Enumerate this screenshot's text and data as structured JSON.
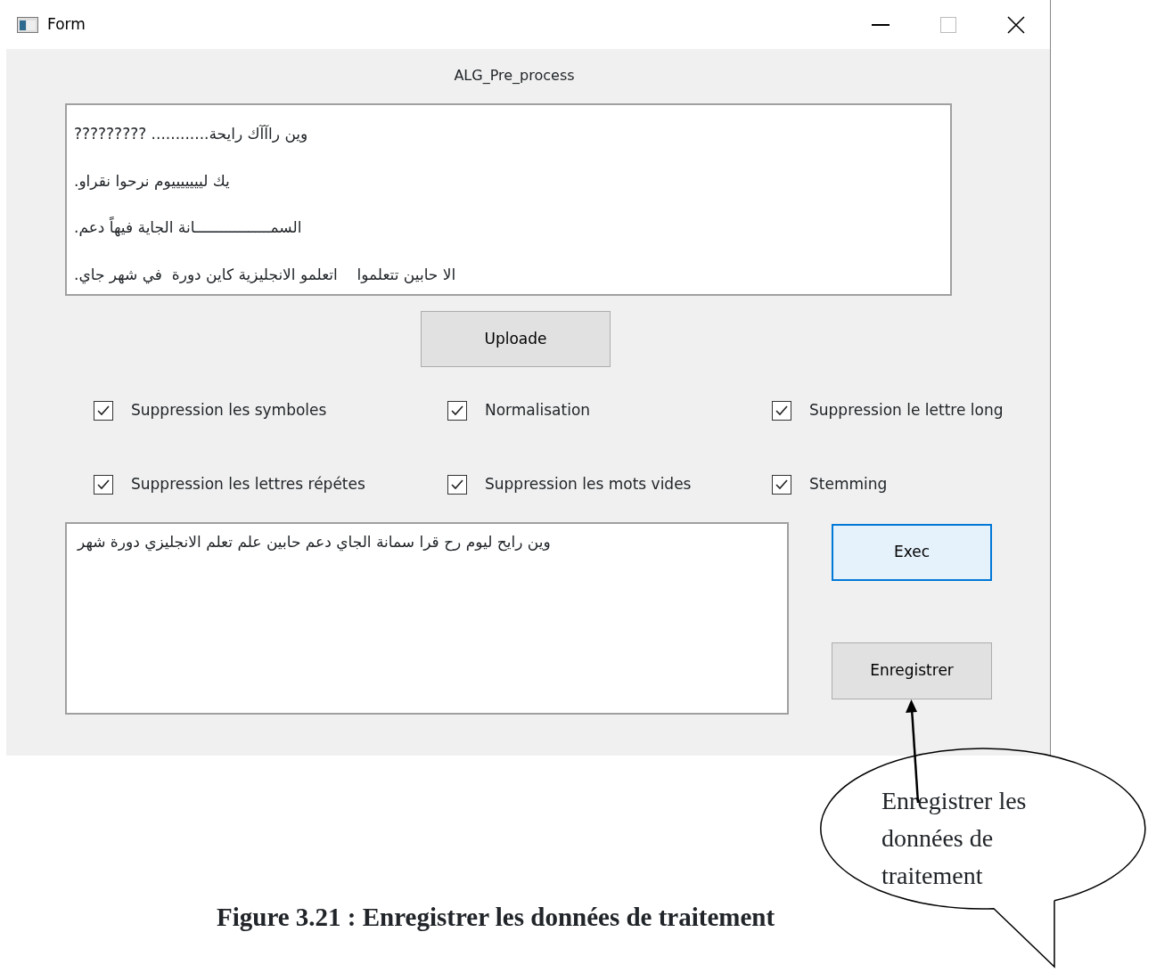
{
  "window": {
    "title": "Form"
  },
  "heading": "ALG_Pre_process",
  "input_lines": [
    "وين راآآك رايحة............ ?????????",
    "يك ليييييييوم نرحوا نقراو.",
    "السمـــــــــــــــــانة الجاية فيهاً دعم.",
    "الا حابين تتعلموا    اتعلمو الانجليزية كاين دورة  في شهر جاي."
  ],
  "upload_button": {
    "label": "Uploade"
  },
  "options": [
    {
      "label": "Suppression les symboles",
      "checked": true
    },
    {
      "label": "Normalisation",
      "checked": true
    },
    {
      "label": "Suppression le lettre long",
      "checked": true
    },
    {
      "label": "Suppression les lettres répétes",
      "checked": true
    },
    {
      "label": "Suppression les mots vides",
      "checked": true
    },
    {
      "label": "Stemming",
      "checked": true
    }
  ],
  "output_text": "وين رايح ليوم رح قرا سمانة الجاي دعم حابين علم تعلم الانجليزي دورة شهر",
  "action_buttons": [
    {
      "label": "Exec",
      "focused": true
    },
    {
      "label": "Enregistrer",
      "focused": false
    }
  ],
  "callout": {
    "lines": [
      "Enregistrer les",
      "données de",
      "traitement"
    ]
  },
  "caption": "Figure 3.21 : Enregistrer les données de traitement"
}
